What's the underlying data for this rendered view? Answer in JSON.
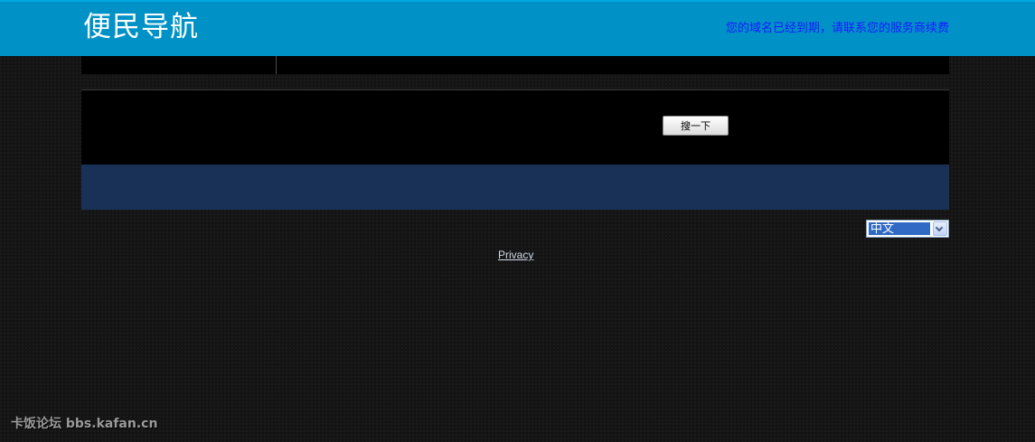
{
  "header": {
    "site_title": "便民导航",
    "notice": "您的域名已经到期，请联系您的服务商续费"
  },
  "search": {
    "button_label": "搜一下"
  },
  "language": {
    "selected": "中文"
  },
  "footer": {
    "privacy_label": "Privacy"
  },
  "watermark": {
    "text": "卡饭论坛 bbs.kafan.cn"
  }
}
